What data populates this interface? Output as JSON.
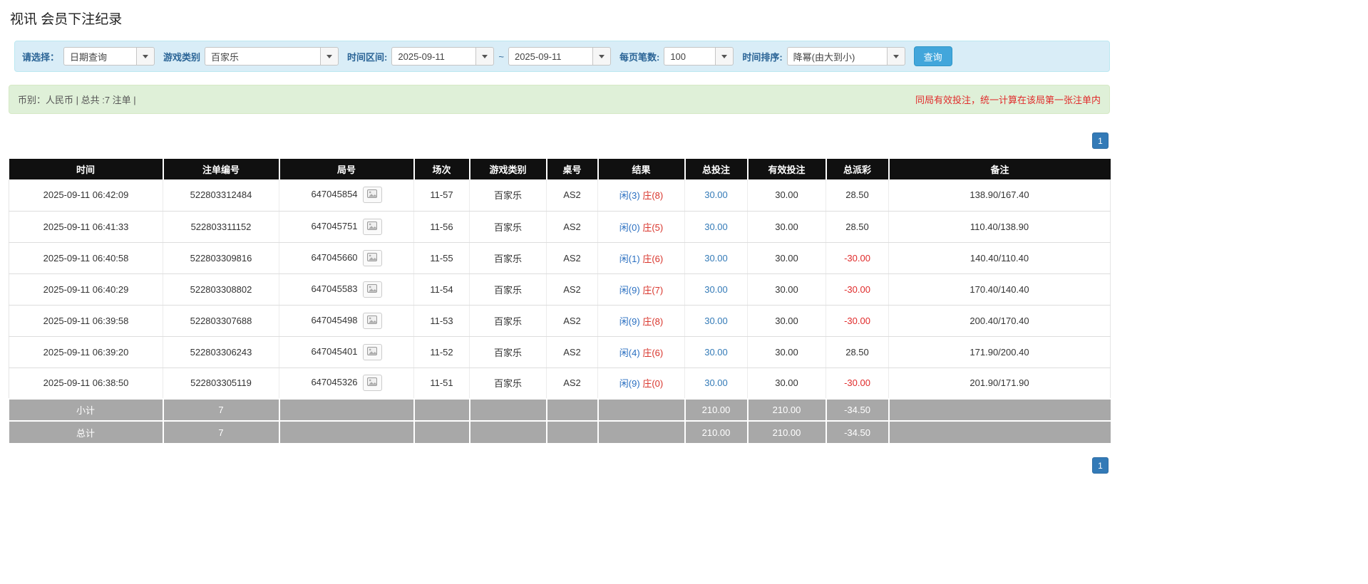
{
  "page": {
    "title": "视讯 会员下注纪录"
  },
  "filter_bar": {
    "select_label": "请选择：",
    "select_value": "日期查询",
    "game_type_label": "游戏类别",
    "game_type_value": "百家乐",
    "time_range_label": "时间区间:",
    "date_from": "2025-09-11",
    "range_separator": "~",
    "date_to": "2025-09-11",
    "page_size_label": "每页笔数:",
    "page_size_value": "100",
    "sort_label": "时间排序:",
    "sort_value": "降幂(由大到小)",
    "search_button_label": "查询"
  },
  "summary_bar": {
    "left_text": "币别：人民币 | 总共 :7 注单 |",
    "right_text": "同局有效投注，统一计算在该局第一张注单内"
  },
  "pagination": {
    "current_page": "1"
  },
  "table": {
    "headers": [
      "时间",
      "注单编号",
      "局号",
      "场次",
      "游戏类别",
      "桌号",
      "结果",
      "总投注",
      "有效投注",
      "总派彩",
      "备注"
    ],
    "rows": [
      {
        "time": "2025-09-11 06:42:09",
        "bet_no": "522803312484",
        "round_no": "647045854",
        "session": "11-57",
        "game_type": "百家乐",
        "table_no": "AS2",
        "result_player": "闲(3)",
        "result_banker": "庄(8)",
        "total_bet": "30.00",
        "valid_bet": "30.00",
        "payout": "28.50",
        "remark": "138.90/167.40"
      },
      {
        "time": "2025-09-11 06:41:33",
        "bet_no": "522803311152",
        "round_no": "647045751",
        "session": "11-56",
        "game_type": "百家乐",
        "table_no": "AS2",
        "result_player": "闲(0)",
        "result_banker": "庄(5)",
        "total_bet": "30.00",
        "valid_bet": "30.00",
        "payout": "28.50",
        "remark": "110.40/138.90"
      },
      {
        "time": "2025-09-11 06:40:58",
        "bet_no": "522803309816",
        "round_no": "647045660",
        "session": "11-55",
        "game_type": "百家乐",
        "table_no": "AS2",
        "result_player": "闲(1)",
        "result_banker": "庄(6)",
        "total_bet": "30.00",
        "valid_bet": "30.00",
        "payout": "-30.00",
        "remark": "140.40/110.40"
      },
      {
        "time": "2025-09-11 06:40:29",
        "bet_no": "522803308802",
        "round_no": "647045583",
        "session": "11-54",
        "game_type": "百家乐",
        "table_no": "AS2",
        "result_player": "闲(9)",
        "result_banker": "庄(7)",
        "total_bet": "30.00",
        "valid_bet": "30.00",
        "payout": "-30.00",
        "remark": "170.40/140.40"
      },
      {
        "time": "2025-09-11 06:39:58",
        "bet_no": "522803307688",
        "round_no": "647045498",
        "session": "11-53",
        "game_type": "百家乐",
        "table_no": "AS2",
        "result_player": "闲(9)",
        "result_banker": "庄(8)",
        "total_bet": "30.00",
        "valid_bet": "30.00",
        "payout": "-30.00",
        "remark": "200.40/170.40"
      },
      {
        "time": "2025-09-11 06:39:20",
        "bet_no": "522803306243",
        "round_no": "647045401",
        "session": "11-52",
        "game_type": "百家乐",
        "table_no": "AS2",
        "result_player": "闲(4)",
        "result_banker": "庄(6)",
        "total_bet": "30.00",
        "valid_bet": "30.00",
        "payout": "28.50",
        "remark": "171.90/200.40"
      },
      {
        "time": "2025-09-11 06:38:50",
        "bet_no": "522803305119",
        "round_no": "647045326",
        "session": "11-51",
        "game_type": "百家乐",
        "table_no": "AS2",
        "result_player": "闲(9)",
        "result_banker": "庄(0)",
        "total_bet": "30.00",
        "valid_bet": "30.00",
        "payout": "-30.00",
        "remark": "201.90/171.90"
      }
    ],
    "subtotal_row": {
      "label": "小计",
      "count": "7",
      "total_bet": "210.00",
      "valid_bet": "210.00",
      "payout": "-34.50"
    },
    "total_row": {
      "label": "总计",
      "count": "7",
      "total_bet": "210.00",
      "valid_bet": "210.00",
      "payout": "-34.50"
    }
  },
  "colors": {
    "accent_button": "#42a6db",
    "pagination_blue": "#337ab7",
    "player_blue": "#2a6fc1",
    "banker_red": "#d9342b",
    "negative_red": "#e02b2b",
    "link_blue": "#337ab7"
  }
}
